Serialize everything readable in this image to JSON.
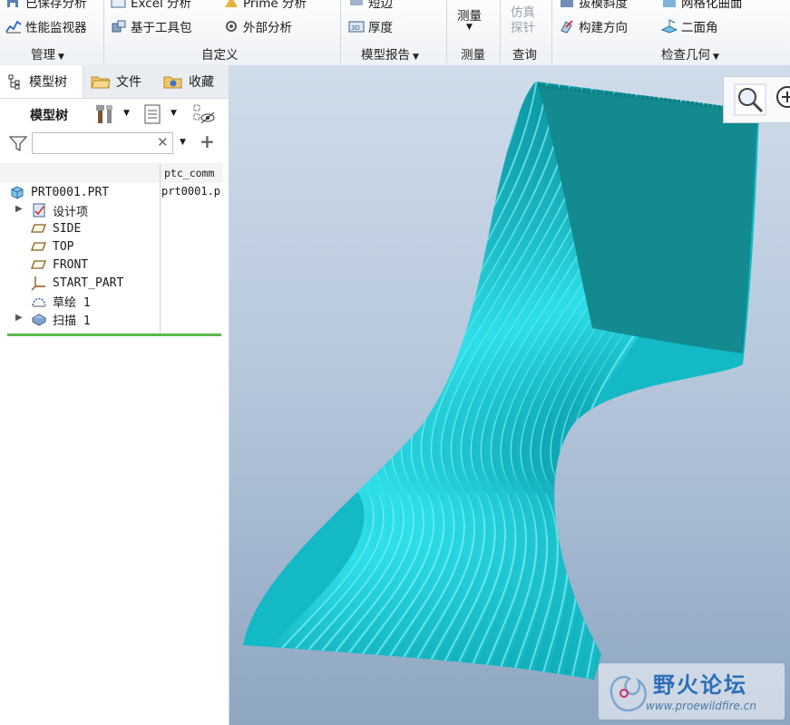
{
  "ribbon": {
    "row1": {
      "saved_analysis": "已保存分析",
      "excel_analysis": "Excel 分析",
      "prime_analysis": "Prime 分析",
      "short_edge": "短边",
      "draft": "拔模斜度",
      "mesh_surface": "网格化曲面"
    },
    "row2": {
      "performance_monitor": "性能监视器",
      "toolkit_based": "基于工具包",
      "external_analysis": "外部分析",
      "thickness": "厚度",
      "build_direction": "构建方向",
      "dihedral_angle": "二面角"
    },
    "measure_button": "测量",
    "sim_probe_line1": "仿真",
    "sim_probe_line2": "探针",
    "groups": {
      "manage": "管理",
      "custom": "自定义",
      "model_report": "模型报告",
      "measure": "测量",
      "inquiry": "查询",
      "inspect_geometry": "检查几何"
    }
  },
  "panel": {
    "tabs": [
      "模型树",
      "文件",
      "收藏"
    ],
    "toolbar_title": "模型树",
    "search": {
      "placeholder": "",
      "value": ""
    },
    "column_header": "ptc_comm",
    "column_value": "prt0001.p",
    "tree": {
      "root": "PRT0001.PRT",
      "items": [
        {
          "label": "设计项",
          "icon": "design-items-icon",
          "expandable": true
        },
        {
          "label": "SIDE",
          "icon": "datum-plane-icon",
          "expandable": false
        },
        {
          "label": "TOP",
          "icon": "datum-plane-icon",
          "expandable": false
        },
        {
          "label": "FRONT",
          "icon": "datum-plane-icon",
          "expandable": false
        },
        {
          "label": "START_PART",
          "icon": "coordinate-system-icon",
          "expandable": false
        },
        {
          "label": "草绘 1",
          "icon": "sketch-icon",
          "expandable": false
        },
        {
          "label": "扫描 1",
          "icon": "sweep-icon",
          "expandable": true
        }
      ]
    }
  },
  "watermark": {
    "title": "野火论坛",
    "url": "www.proewildfire.cn"
  },
  "colors": {
    "model_fill": "#1fd0dc",
    "model_inner": "#138a8f",
    "insert_bar": "#5bb84d",
    "background_top": "#cfdcea",
    "background_bottom": "#8ea6c2"
  }
}
